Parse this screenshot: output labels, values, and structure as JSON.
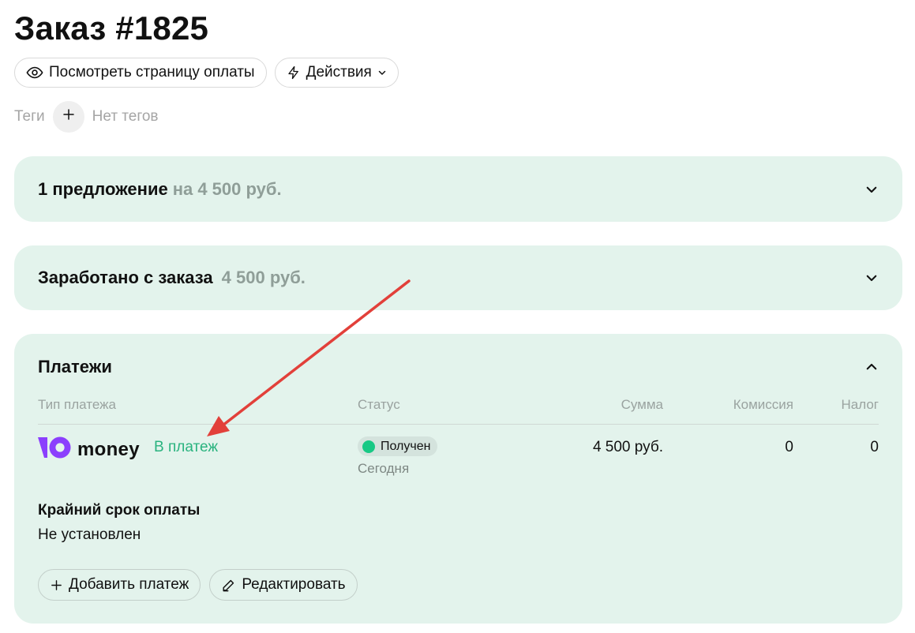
{
  "page_title": "Заказ #1825",
  "toolbar": {
    "view_payment_label": "Посмотреть страницу оплаты",
    "actions_label": "Действия"
  },
  "tags": {
    "label": "Теги",
    "empty_text": "Нет тегов"
  },
  "offers_card": {
    "title": "1 предложение",
    "amount": "на 4 500 руб."
  },
  "earned_card": {
    "title": "Заработано с заказа",
    "amount": "4 500 руб."
  },
  "payments_card": {
    "title": "Платежи",
    "columns": {
      "type": "Тип платежа",
      "status": "Статус",
      "sum": "Сумма",
      "commission": "Комиссия",
      "tax": "Налог"
    },
    "row": {
      "provider": "money",
      "link": "В платеж",
      "status": "Получен",
      "status_date": "Сегодня",
      "sum": "4 500 руб.",
      "commission": "0",
      "tax": "0"
    },
    "deadline_label": "Крайний срок оплаты",
    "deadline_value": "Не установлен",
    "add_payment_label": "Добавить платеж",
    "edit_label": "Редактировать"
  },
  "colors": {
    "card_bg": "#e3f3ec",
    "accent_green": "#2ab37f",
    "status_dot": "#18c985",
    "yoomoney_purple": "#8b3ffd",
    "annotation_arrow": "#e2403a"
  }
}
